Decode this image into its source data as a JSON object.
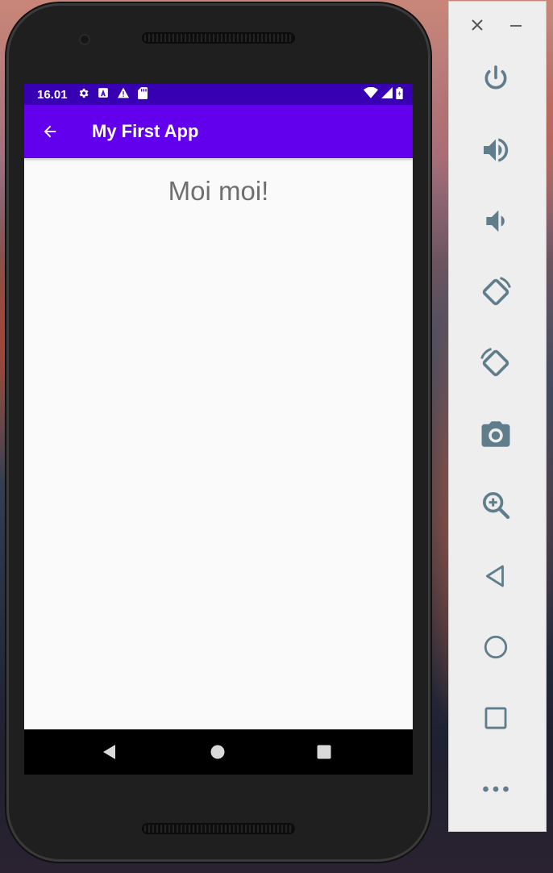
{
  "status_bar": {
    "time": "16.01",
    "left_icons": [
      "settings-icon",
      "a-icon",
      "warning-icon",
      "sd-card-icon"
    ],
    "right_icons": [
      "wifi-icon",
      "signal-icon",
      "battery-icon"
    ]
  },
  "app_bar": {
    "title": "My First App",
    "back_icon": "arrow-left-icon"
  },
  "content": {
    "message": "Moi moi!"
  },
  "nav_bar": {
    "buttons": [
      "back-triangle-icon",
      "home-circle-icon",
      "recents-square-icon"
    ]
  },
  "emulator_panel": {
    "window_controls": [
      "close-icon",
      "minimize-icon"
    ],
    "controls": [
      "power",
      "volume-up",
      "volume-down",
      "rotate-left",
      "rotate-right",
      "screenshot",
      "zoom",
      "back",
      "home",
      "overview",
      "more"
    ]
  },
  "colors": {
    "status_bar": "#3700b3",
    "app_bar": "#6200ee",
    "screen_bg": "#fafafa",
    "message_text": "#6f6f6f",
    "panel_icon": "#607d8b"
  }
}
